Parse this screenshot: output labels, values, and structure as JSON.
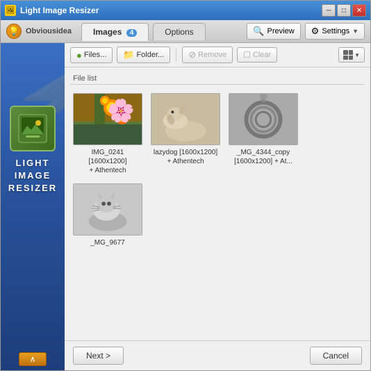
{
  "window": {
    "title": "Light Image Resizer",
    "title_bar_icon": "🖼",
    "minimize_label": "─",
    "maximize_label": "□",
    "close_label": "✕"
  },
  "obvious_idea": {
    "label": "Obviousidea"
  },
  "tabs": {
    "images_label": "Images",
    "images_count": "4",
    "options_label": "Options",
    "preview_label": "Preview",
    "settings_label": "Settings"
  },
  "toolbar": {
    "files_label": "Files...",
    "folder_label": "Folder...",
    "remove_label": "Remove",
    "clear_label": "Clear"
  },
  "file_list": {
    "label": "File list",
    "items": [
      {
        "name": "IMG_0241\n[1600x1200] + Athentech",
        "thumb_type": "flowers"
      },
      {
        "name": "lazydog [1600x1200] + Athentech",
        "thumb_type": "dog"
      },
      {
        "name": "_MG_4344_copy [1600x1200] + At...",
        "thumb_type": "rope"
      },
      {
        "name": "_MG_9677",
        "thumb_type": "cat"
      }
    ]
  },
  "sidebar": {
    "lightning": "⚡",
    "brand": "LIGHT\nIMAGE\nRESIZER",
    "arrow_label": "∧"
  },
  "bottom": {
    "next_label": "Next >",
    "cancel_label": "Cancel"
  }
}
